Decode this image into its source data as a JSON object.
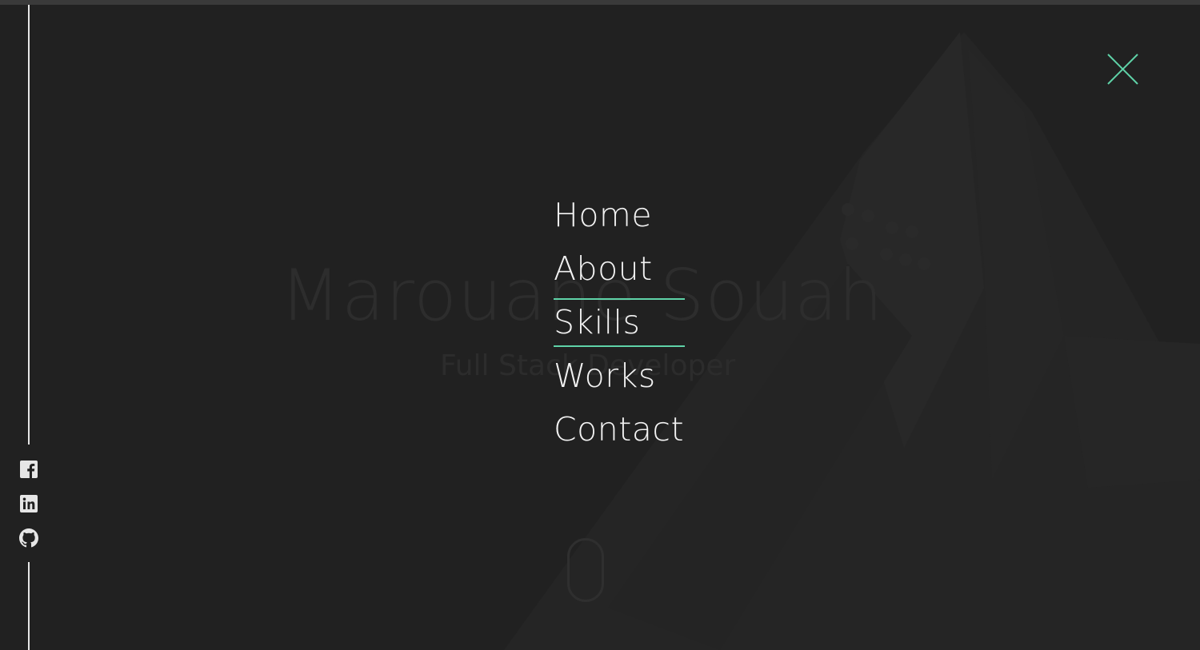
{
  "hero": {
    "name": "Marouane Souah",
    "role": "Full Stack Developer"
  },
  "menu": {
    "items": [
      {
        "label": "Home",
        "active": false
      },
      {
        "label": "About",
        "active": false
      },
      {
        "label": "Skills",
        "active": true
      },
      {
        "label": "Works",
        "active": false
      },
      {
        "label": "Contact",
        "active": false
      }
    ]
  },
  "social": {
    "icons": [
      "facebook-icon",
      "linkedin-icon",
      "github-icon"
    ]
  },
  "colors": {
    "background": "#212121",
    "accent": "#5fd3a8",
    "menu_text": "#f2f2f2",
    "rail": "#e6e6e6"
  }
}
